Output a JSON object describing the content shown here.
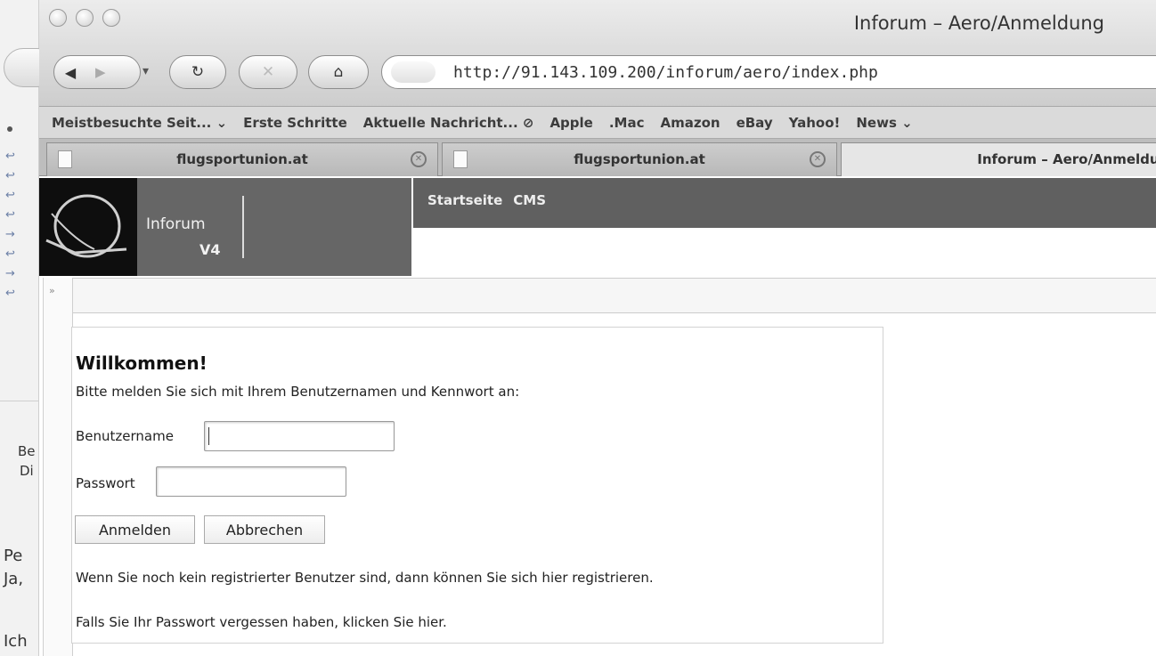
{
  "window": {
    "title": "Inforum – Aero/Anmeldung"
  },
  "toolbar": {
    "url": "http://91.143.109.200/inforum/aero/index.php",
    "back_icon": "back-arrow-icon",
    "forward_icon": "forward-arrow-icon",
    "reload_icon": "reload-icon",
    "stop_icon": "stop-icon",
    "home_icon": "home-icon"
  },
  "bookmarks": [
    "Meistbesuchte Seit... ⌄",
    "Erste Schritte",
    "Aktuelle Nachricht... ⊘",
    "Apple",
    ".Mac",
    "Amazon",
    "eBay",
    "Yahoo!",
    "News ⌄"
  ],
  "tabs": [
    {
      "label": "flugsportunion.at",
      "active": false
    },
    {
      "label": "flugsportunion.at",
      "active": false
    },
    {
      "label": "Inforum – Aero/Anmeldur",
      "active": true
    }
  ],
  "app": {
    "brand_line1": "Inforum",
    "brand_line2": "V4",
    "nav": [
      "Startseite",
      "CMS"
    ],
    "sidebar_toggle": "»"
  },
  "login": {
    "heading": "Willkommen!",
    "intro": "Bitte melden Sie sich mit Ihrem Benutzernamen und Kennwort an:",
    "username_label": "Benutzername",
    "username_value": "",
    "password_label": "Passwort",
    "password_value": "",
    "submit_label": "Anmelden",
    "cancel_label": "Abbrechen",
    "register_note": "Wenn Sie noch kein registrierter Benutzer sind, dann können Sie sich hier registrieren.",
    "forgot_note": "Falls Sie Ihr Passwort vergessen haben, klicken Sie hier."
  },
  "background_window": {
    "text_fragments": [
      "Be",
      "Di",
      "Pe",
      "Ja,",
      "Ich"
    ]
  }
}
